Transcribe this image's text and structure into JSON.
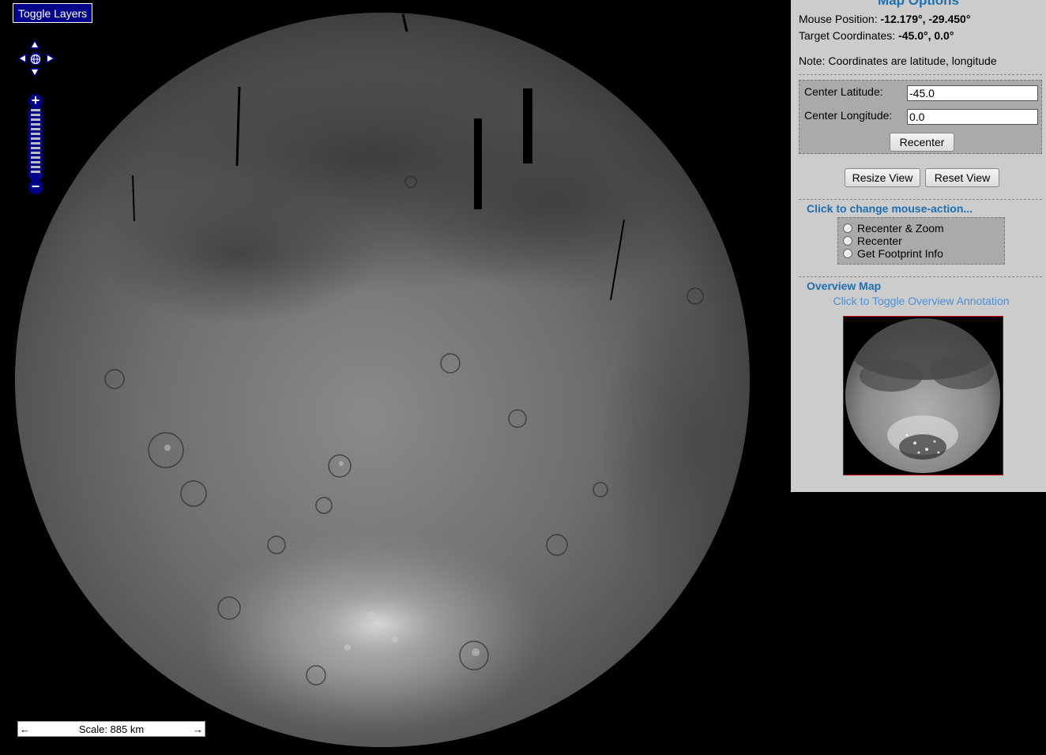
{
  "map": {
    "toggle_layers_label": "Toggle Layers",
    "scale_label": "Scale: 885 km",
    "scale_left_arrow": "←",
    "scale_right_arrow": "→",
    "zoom_in_label": "+",
    "zoom_out_label": "−"
  },
  "panel": {
    "title": "Map Options",
    "mouse_position_label": "Mouse Position:",
    "mouse_position_value": "-12.179°, -29.450°",
    "target_coords_label": "Target Coordinates:",
    "target_coords_value": "-45.0°, 0.0°",
    "note": "Note: Coordinates are latitude, longitude",
    "center_lat_label": "Center Latitude:",
    "center_lat_value": "-45.0",
    "center_lon_label": "Center Longitude:",
    "center_lon_value": "0.0",
    "recenter_button": "Recenter",
    "resize_view_button": "Resize View",
    "reset_view_button": "Reset View",
    "mouse_action_heading": "Click to change mouse-action...",
    "mouse_actions": [
      "Recenter & Zoom",
      "Recenter",
      "Get Footprint Info"
    ],
    "overview_heading": "Overview Map",
    "overview_toggle_link": "Click to Toggle Overview Annotation"
  },
  "colors": {
    "panel_bg": "#cccccc",
    "heading_blue": "#1f6fb0",
    "link_blue": "#4a8fd8",
    "control_navy": "#00008b"
  }
}
